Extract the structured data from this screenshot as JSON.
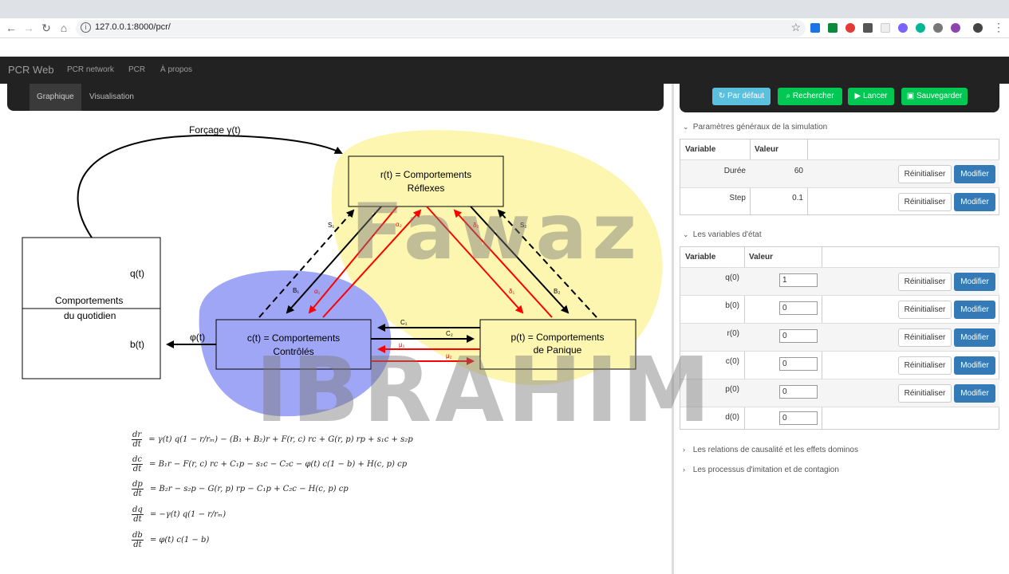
{
  "browser": {
    "url": "127.0.0.1:8000/pcr/"
  },
  "navbar": {
    "brand": "PCR Web",
    "items": [
      "PCR network",
      "PCR",
      "À propos"
    ]
  },
  "subnav": {
    "tabs": [
      "Graphique",
      "Visualisation"
    ],
    "active": "Graphique"
  },
  "actions": {
    "default_label": "Par défaut",
    "search_label": "Rechercher",
    "run_label": "Lancer",
    "save_label": "Sauvegarder"
  },
  "sim_params": {
    "title": "Paramètres généraux de la simulation",
    "col_variable": "Variable",
    "col_value": "Valeur",
    "rows": [
      {
        "name": "Durée",
        "value": "60"
      },
      {
        "name": "Step",
        "value": "0.1"
      }
    ]
  },
  "state_vars": {
    "title": "Les variables d'état",
    "col_variable": "Variable",
    "col_value": "Valeur",
    "rows": [
      {
        "name": "q(0)",
        "value": "1",
        "has_actions": true
      },
      {
        "name": "b(0)",
        "value": "0",
        "has_actions": true
      },
      {
        "name": "r(0)",
        "value": "0",
        "has_actions": true
      },
      {
        "name": "c(0)",
        "value": "0",
        "has_actions": true
      },
      {
        "name": "p(0)",
        "value": "0",
        "has_actions": true
      },
      {
        "name": "d(0)",
        "value": "0",
        "has_actions": false
      }
    ]
  },
  "row_buttons": {
    "reset_label": "Réinitialiser",
    "modify_label": "Modifier"
  },
  "collapsed_sections": [
    "Les relations de causalité et les effets dominos",
    "Les processus d'imitation et de contagion"
  ],
  "diagram": {
    "forcing_label": "Forçage γ(t)",
    "daily_box": {
      "q_label": "q(t)",
      "title_line1": "Comportements",
      "title_line2": "du quotidien",
      "b_label": "b(t)"
    },
    "phi_label": "φ(t)",
    "r_box": {
      "line1": "r(t) = Comportements",
      "line2": "Réflexes"
    },
    "c_box": {
      "line1": "c(t) = Comportements",
      "line2": "Contrôlés"
    },
    "p_box": {
      "line1": "p(t) = Comportements",
      "line2": "de Panique"
    },
    "edge_labels": {
      "s1": "S₁",
      "b1": "B₁",
      "a2": "α₂",
      "a1": "α₁",
      "d2": "δ₂",
      "d1": "δ₁",
      "s2": "S₂",
      "b2": "B₂",
      "c1": "C₁",
      "c2": "C₂",
      "mu1": "μ₁",
      "mu2": "μ₂"
    }
  },
  "equations": [
    {
      "lhs_num": "dr",
      "lhs_den": "dt",
      "rhs": "= γ(t) q(1 − r/rₘ) − (B₁ + B₂)r + F(r, c) rc + G(r, p) rp + s₁c + s₂p"
    },
    {
      "lhs_num": "dc",
      "lhs_den": "dt",
      "rhs": "= B₁r − F(r, c) rc + C₁p − s₁c − C₂c − φ(t) c(1 − b) + H(c, p) cp"
    },
    {
      "lhs_num": "dp",
      "lhs_den": "dt",
      "rhs": "= B₂r − s₂p − G(r, p) rp − C₁p + C₂c − H(c, p) cp"
    },
    {
      "lhs_num": "dq",
      "lhs_den": "dt",
      "rhs": "= −γ(t) q(1 − r/rₘ)"
    },
    {
      "lhs_num": "db",
      "lhs_den": "dt",
      "rhs": "= φ(t) c(1 − b)"
    }
  ],
  "watermark": {
    "line1": "Fawaz",
    "line2": "IBRAHIM"
  },
  "colors": {
    "navbar": "#222222",
    "info": "#5bc0de",
    "success": "#00c853",
    "primary": "#337ab7",
    "yellow_blob": "#fdf6b0",
    "blue_blob": "#9fa6f5",
    "red_arrow": "#ff0000"
  }
}
